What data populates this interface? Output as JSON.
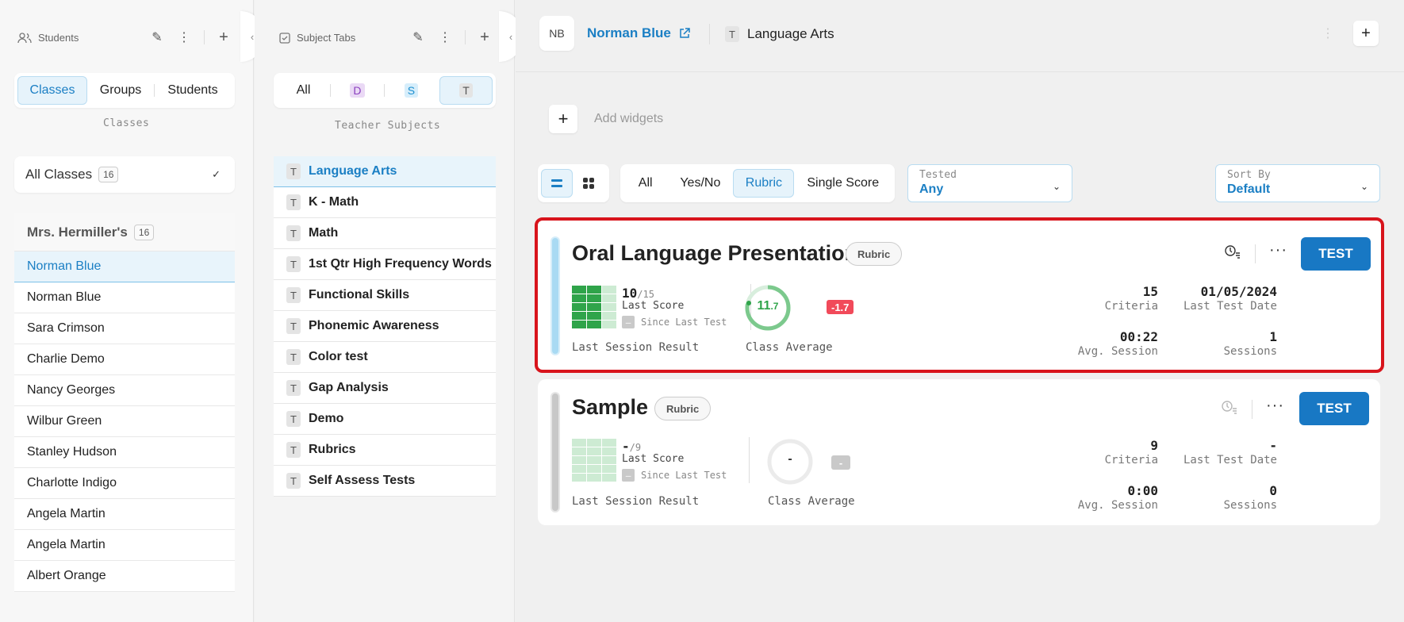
{
  "students_panel": {
    "title": "Students",
    "segments": [
      "Classes",
      "Groups",
      "Students"
    ],
    "active_segment": "Classes",
    "caption": "Classes",
    "all_classes": {
      "label": "All Classes",
      "count": "16"
    },
    "class_group": {
      "label": "Mrs. Hermiller's",
      "count": "16"
    },
    "students": [
      "Norman Blue",
      "Norman Blue",
      "Sara Crimson",
      "Charlie Demo",
      "Nancy Georges",
      "Wilbur Green",
      "Stanley Hudson",
      "Charlotte Indigo",
      "Angela Martin",
      "Angela Martin",
      "Albert Orange"
    ]
  },
  "subjects_panel": {
    "title": "Subject Tabs",
    "filters": [
      "All",
      "D",
      "S",
      "T"
    ],
    "active_filter": "T",
    "caption": "Teacher Subjects",
    "chip": "T",
    "subjects": [
      "Language Arts",
      "K - Math",
      "Math",
      "1st Qtr High Frequency Words",
      "Functional Skills",
      "Phonemic Awareness",
      "Color test",
      "Gap Analysis",
      "Demo",
      "Rubrics",
      "Self Assess Tests"
    ]
  },
  "header": {
    "avatar": "NB",
    "student_name": "Norman Blue",
    "subject_chip": "T",
    "subject": "Language Arts"
  },
  "widgets": {
    "add_label": "Add widgets"
  },
  "filter_bar": {
    "types": [
      "All",
      "Yes/No",
      "Rubric",
      "Single Score"
    ],
    "active_type": "Rubric",
    "tested": {
      "label": "Tested",
      "value": "Any"
    },
    "sort": {
      "label": "Sort By",
      "value": "Default"
    }
  },
  "tests": [
    {
      "title": "Oral Language Presentation",
      "type_badge": "Rubric",
      "test_button": "TEST",
      "score": "10",
      "score_of": "/15",
      "last_score_label": "Last Score",
      "since_label": "Since Last Test",
      "since_value": "–",
      "last_session_label": "Last Session Result",
      "class_avg_int": "11",
      "class_avg_dec": ".7",
      "class_avg_fraction": 0.78,
      "delta": "-1.7",
      "class_avg_label": "Class Average",
      "criteria": "15",
      "criteria_label": "Criteria",
      "last_test_date": "01/05/2024",
      "last_test_date_label": "Last Test Date",
      "avg_session": "00:22",
      "avg_session_label": "Avg. Session",
      "sessions": "1",
      "sessions_label": "Sessions",
      "highlighted": true,
      "accent": "#a9daf3"
    },
    {
      "title": "Sample",
      "type_badge": "Rubric",
      "test_button": "TEST",
      "score": "-",
      "score_of": "/9",
      "last_score_label": "Last Score",
      "since_label": "Since Last Test",
      "since_value": "–",
      "last_session_label": "Last Session Result",
      "class_avg_int": "-",
      "class_avg_dec": "",
      "class_avg_fraction": 0,
      "delta": "-",
      "class_avg_label": "Class Average",
      "criteria": "9",
      "criteria_label": "Criteria",
      "last_test_date": "-",
      "last_test_date_label": "Last Test Date",
      "avg_session": "0:00",
      "avg_session_label": "Avg. Session",
      "sessions": "0",
      "sessions_label": "Sessions",
      "highlighted": false,
      "accent": "#c8c8c8"
    }
  ],
  "colors": {
    "accent": "#1b7fc4",
    "button": "#1878c4",
    "highlight": "#d8141c",
    "delta": "#f14a5a",
    "score_green": "#2fa44a"
  }
}
